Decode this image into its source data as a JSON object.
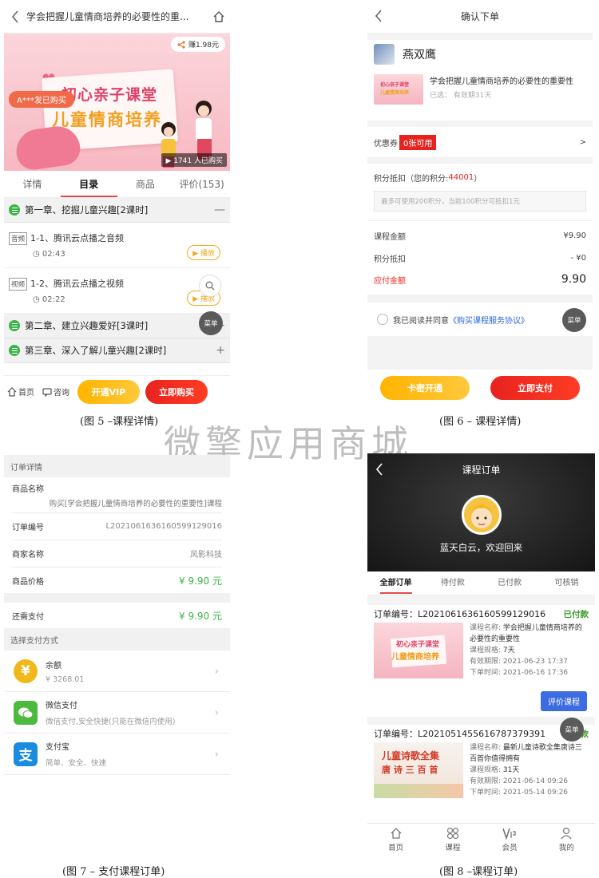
{
  "watermark": "微擎应用商城",
  "captions": {
    "fig5": "(图 5 –课程详情)",
    "fig6": "(图 6 –  课程详情)",
    "fig7": "(图 7 –  支付课程订单)",
    "fig8": "(图 8 –课程订单)"
  },
  "fig5": {
    "title": "学会把握儿童情商培养的必要性的重...",
    "banner": {
      "line1": "初心亲子课堂",
      "line2": "儿童情商培养",
      "bought_tag": "A***发已购买",
      "earn": "赚1.98元",
      "buyers": "1741 人已购买"
    },
    "tabs": [
      "详情",
      "目录",
      "商品",
      "评价(153)"
    ],
    "chapters": [
      {
        "title": "第一章、挖掘儿童兴趣[2课时]",
        "sign": "—"
      },
      {
        "title": "第二章、建立兴趣爱好[3课时]",
        "sign": "+"
      },
      {
        "title": "第三章、深入了解儿童兴趣[2课时]",
        "sign": "+"
      }
    ],
    "lessons": [
      {
        "type": "音频",
        "title": "1-1、腾讯云点播之音频",
        "time": "02:43",
        "play": "播放"
      },
      {
        "type": "视频",
        "title": "1-2、腾讯云点播之视频",
        "time": "02:22",
        "play": "播放"
      }
    ],
    "menu": "菜单",
    "bottom": {
      "home": "首页",
      "consult": "咨询",
      "vip": "开通VIP",
      "buy": "立即购买"
    }
  },
  "fig6": {
    "title": "确认下单",
    "shop_name": "燕双鹰",
    "item_title": "学会把握儿童情商培养的必要性的重要性",
    "item_sub": "已选： 有效期31天",
    "coupon_label": "优惠券",
    "coupon_badge": "0张可用",
    "coupon_arrow": ">",
    "points_label": "积分抵扣（您的积分: ",
    "points_value": "44001",
    "points_end": "）",
    "points_placeholder": "最多可使用200积分，当前100积分可抵扣1元",
    "lines": [
      {
        "label": "课程金额",
        "value": "¥9.90"
      },
      {
        "label": "积分抵扣",
        "value": "- ¥0"
      }
    ],
    "payable_label": "应付金额",
    "payable_value": "9.90",
    "agree_text": "我已阅读并同意",
    "agree_link": "《购买课程服务协议》",
    "menu": "菜单",
    "card_btn": "卡密开通",
    "pay_btn": "立即支付"
  },
  "fig7": {
    "section1": "订单详情",
    "product_label": "商品名称",
    "product_value": "购买[学会把握儿童情商培养的必要性的重要性]课程",
    "order_no_label": "订单编号",
    "order_no": "L2021061636160599129016",
    "merchant_label": "商家名称",
    "merchant": "风影科技",
    "price_label": "商品价格",
    "price": "¥ 9.90 元",
    "due_label": "还需支付",
    "due": "¥ 9.90 元",
    "section2": "选择支付方式",
    "methods": [
      {
        "name": "余额",
        "desc": "¥  3268.01",
        "color": "#f0b81a",
        "icon": "¥"
      },
      {
        "name": "微信支付",
        "desc": "微信支付,安全快捷(只能在微信内使用)",
        "color": "#4cba3c",
        "icon": "wechat-icon"
      },
      {
        "name": "支付宝",
        "desc": "简单、安全、快速",
        "color": "#1a8ce0",
        "icon": "支"
      }
    ]
  },
  "fig8": {
    "title": "课程订单",
    "welcome": "蓝天白云，欢迎回来",
    "tabs": [
      "全部订单",
      "待付款",
      "已付款",
      "可核销"
    ],
    "orders": [
      {
        "no": "订单编号：L2021061636160599129016",
        "status": "已付款",
        "course_label": "课程名称:",
        "course": "学会把握儿童情商培养的必要性的重要性",
        "spec_label": "课程规格:",
        "spec": "7天",
        "valid_label": "有效期限:",
        "valid": "2021-06-23 17:37",
        "time_label": "下单时间:",
        "time": "2021-06-16 17:36",
        "thumb1": "初心亲子课堂",
        "thumb2": "儿童情商培养",
        "button": "评价课程"
      },
      {
        "no": "订单编号：L2021051455616787379391",
        "status": "已付款",
        "course_label": "课程名称:",
        "course": "最新儿童诗歌全集唐诗三百首你值得拥有",
        "spec_label": "课程规格:",
        "spec": "31天",
        "valid_label": "有效期限:",
        "valid": "2021-06-14 09:26",
        "time_label": "下单时间:",
        "time": "2021-05-14 09:26",
        "thumb1": "儿童诗歌全集",
        "thumb2": "唐 诗 三 百 首"
      }
    ],
    "menu": "菜单",
    "tabbar": [
      "首页",
      "课程",
      "会员",
      "我的"
    ]
  }
}
